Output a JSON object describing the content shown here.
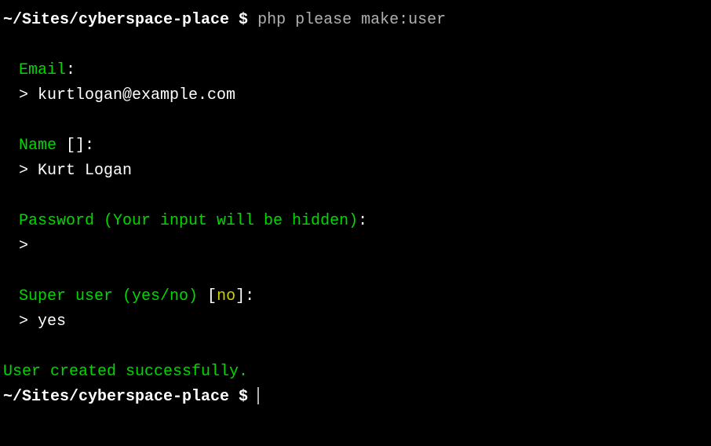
{
  "prompt1": {
    "path": "~/Sites/cyberspace-place",
    "sep": " $ ",
    "command": "php please make:user"
  },
  "email": {
    "label": "Email",
    "colon": ":",
    "prefix": "> ",
    "value": "kurtlogan@example.com"
  },
  "name": {
    "label": "Name ",
    "bracket_open": "[",
    "default": "",
    "bracket_close": "]",
    "colon": ":",
    "prefix": "> ",
    "value": "Kurt Logan"
  },
  "password": {
    "label": "Password (Your input will be hidden)",
    "colon": ":",
    "prefix": "> ",
    "value": ""
  },
  "superuser": {
    "label": "Super user (yes/no) ",
    "bracket_open": "[",
    "default": "no",
    "bracket_close": "]",
    "colon": ":",
    "prefix": "> ",
    "value": "yes"
  },
  "success": "User created successfully.",
  "prompt2": {
    "path": "~/Sites/cyberspace-place",
    "sep": " $ "
  }
}
